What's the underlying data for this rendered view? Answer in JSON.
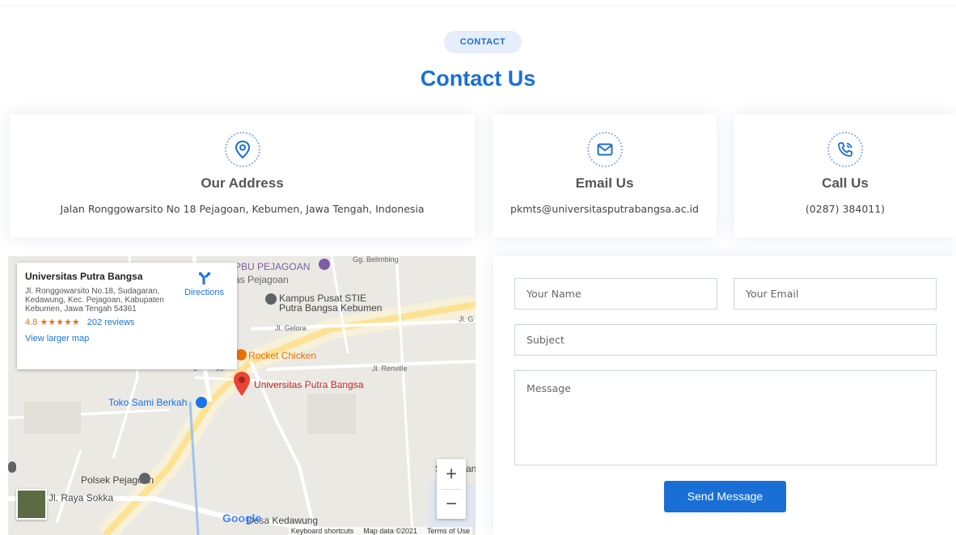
{
  "section": {
    "badge": "CONTACT",
    "title": "Contact Us"
  },
  "cards": [
    {
      "title": "Our Address",
      "text": "Jalan Ronggowarsito No 18 Pejagoan, Kebumen, Jawa Tengah, Indonesia",
      "icon": "location-pin-icon"
    },
    {
      "title": "Email Us",
      "text": "pkmts@universitasputrabangsa.ac.id",
      "icon": "envelope-icon"
    },
    {
      "title": "Call Us",
      "text": "(0287) 384011)",
      "icon": "phone-call-icon"
    }
  ],
  "map": {
    "place_name": "Universitas Putra Bangsa",
    "place_address": "Jl. Ronggowarsito No.18, Sudagaran, Kedawung, Kec. Pejagoan, Kabupaten Kebumen, Jawa Tengah 54361",
    "rating": "4.8",
    "stars": "★★★★★",
    "reviews": "202 reviews",
    "directions": "Directions",
    "view_larger": "View larger map",
    "labels": {
      "spbu": "PBU PEJAGOAN",
      "pejagoan": "as Pejagoan",
      "kampus1": "Kampus Pusat STIE",
      "kampus2": "Putra Bangsa Kebumen",
      "rocket": "Rocket Chicken",
      "upb": "Universitas Putra Bangsa",
      "toko": "Toko Sami Berkah",
      "polsek": "Polsek Pejagoan",
      "raya": "Jl. Raya Sokka",
      "desa": "Desa Kedawung",
      "belimbing": "Gg. Belimbing",
      "gelora": "Jl. Gelora",
      "renville": "Jl. Renville",
      "mangga": "Gg. Mangga",
      "jlg": "Jl. G",
      "s": "S",
      "an": "an"
    },
    "zoom_in": "+",
    "zoom_out": "−",
    "google": "Google",
    "footer": {
      "shortcuts": "Keyboard shortcuts",
      "data": "Map data ©2021",
      "terms": "Terms of Use"
    }
  },
  "form": {
    "name_placeholder": "Your Name",
    "email_placeholder": "Your Email",
    "subject_placeholder": "Subject",
    "message_placeholder": "Message",
    "send_label": "Send Message"
  },
  "colors": {
    "accent": "#1a6fd6",
    "badge_bg": "#e6eefb",
    "map_marker": "#ea4335",
    "poi_orange": "#e8710a"
  }
}
